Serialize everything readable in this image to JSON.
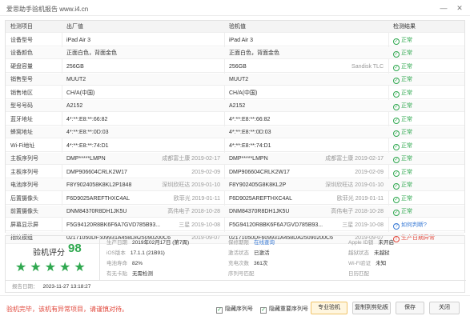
{
  "window": {
    "title": "爱思助手验机报告 www.i4.cn",
    "min": "—",
    "close": "✕"
  },
  "table": {
    "headers": {
      "name": "检测项目",
      "factory": "出厂值",
      "check": "验机值",
      "result": "检测结果"
    },
    "rows": [
      {
        "name": "设备型号",
        "factory": "iPad Air 3",
        "factory_extra": "",
        "check": "iPad Air 3",
        "check_extra": "",
        "result": "正常",
        "status": "ok"
      },
      {
        "name": "设备颜色",
        "factory": "正面白色，背面金色",
        "factory_extra": "",
        "check": "正面白色，背面金色",
        "check_extra": "",
        "result": "正常",
        "status": "ok"
      },
      {
        "name": "硬盘容量",
        "factory": "256GB",
        "factory_extra": "",
        "check": "256GB",
        "check_extra": "Sandisk TLC",
        "result": "正常",
        "status": "ok"
      },
      {
        "name": "销售型号",
        "factory": "MUUT2",
        "factory_extra": "",
        "check": "MUUT2",
        "check_extra": "",
        "result": "正常",
        "status": "ok"
      },
      {
        "name": "销售地区",
        "factory": "CH/A(中国)",
        "factory_extra": "",
        "check": "CH/A(中国)",
        "check_extra": "",
        "result": "正常",
        "status": "ok"
      },
      {
        "name": "型号号码",
        "factory": "A2152",
        "factory_extra": "",
        "check": "A2152",
        "check_extra": "",
        "result": "正常",
        "status": "ok"
      },
      {
        "name": "蓝牙地址",
        "factory": "4*:**:E8:**:66:82",
        "factory_extra": "",
        "check": "4*:**:E8:**:66:82",
        "check_extra": "",
        "result": "正常",
        "status": "ok"
      },
      {
        "name": "蜂窝地址",
        "factory": "4*:**:E8:**:0D:03",
        "factory_extra": "",
        "check": "4*:**:E8:**:0D:03",
        "check_extra": "",
        "result": "正常",
        "status": "ok"
      },
      {
        "name": "Wi-Fi地址",
        "factory": "4*:**:E8:**:74:D1",
        "factory_extra": "",
        "check": "4*:**:E8:**:74:D1",
        "check_extra": "",
        "result": "正常",
        "status": "ok"
      },
      {
        "name": "主板序列号",
        "factory": "DMP*****LMPN",
        "factory_extra": "成都富士康 2019-02-17",
        "check": "DMP*****LMPN",
        "check_extra": "成都富士康 2019-02-17",
        "result": "正常",
        "status": "ok"
      },
      {
        "name": "主板序列号",
        "factory": "DMP906604CRLK2W17",
        "factory_extra": "2019-02-09",
        "check": "DMP906604CRLK2W17",
        "check_extra": "2019-02-09",
        "result": "正常",
        "status": "ok"
      },
      {
        "name": "电池序列号",
        "factory": "F8Y9024058K8KL2P1848",
        "factory_extra": "深圳欣旺达 2019-01-10",
        "check": "F8Y902405G8K8KL2P",
        "check_extra": "深圳欣旺达 2019-01-10",
        "result": "正常",
        "status": "ok"
      },
      {
        "name": "后置摄像头",
        "factory": "F6D9025AREFTHXC4AL",
        "factory_extra": "欧菲光 2019-01-11",
        "check": "F6D9025AREFTHXC4AL",
        "check_extra": "欧菲光 2019-01-11",
        "result": "正常",
        "status": "ok"
      },
      {
        "name": "前置摄像头",
        "factory": "DNM84370R8DH1JK5U",
        "factory_extra": "高伟电子 2018-10-28",
        "check": "DNM84370R8DH1JK5U",
        "check_extra": "高伟电子 2018-10-28",
        "result": "正常",
        "status": "ok"
      },
      {
        "name": "屏幕显示屏",
        "factory": "F5G94120R8BK6F6A7GVD785B93...",
        "factory_extra": "三星 2019-10-08",
        "check": "F5G94120R8BK6F6A7GVD785B93...",
        "check_extra": "三星 2019-10-08",
        "result": "如何判断?",
        "status": "question"
      },
      {
        "name": "指纹模组",
        "factory": "02171050DF609931A458DA25090200C6",
        "factory_extra": "2019-09-07",
        "check": "02171050DF609931A458DA25090200C6",
        "check_extra": "2019-09-07",
        "result": "生产日期异常",
        "status": "bad"
      }
    ]
  },
  "summary": {
    "score_label": "验机评分",
    "score": "98",
    "stars": "★★★★★",
    "items": [
      {
        "k": "生产日期",
        "v": "2019年02月17日 (第7周)"
      },
      {
        "k": "保修期限",
        "v": "在线查询",
        "style": "link"
      },
      {
        "k": "Apple ID锁",
        "v": "未开启"
      },
      {
        "k": "iOS版本",
        "v": "17.1.1 (21B91)"
      },
      {
        "k": "激活状态",
        "v": "已激活"
      },
      {
        "k": "越狱状态",
        "v": "未越狱"
      },
      {
        "k": "电池寿命",
        "v": "82%"
      },
      {
        "k": "充电次数",
        "v": "361次"
      },
      {
        "k": "Wi-Fi验证",
        "v": "未知"
      },
      {
        "k": "有无卡贴",
        "v": "无需检测"
      },
      {
        "k": "序列号匹配",
        "v": ""
      },
      {
        "k": "日历匹配",
        "v": ""
      }
    ],
    "report_time_k": "报告日期：",
    "report_time_v": "2023-11-27 13:18:27"
  },
  "footer": {
    "warning": "验机完毕，该机有异常项目，请谨慎对待。",
    "cb1": "隐藏序列号",
    "cb2": "隐藏重要序列号",
    "btn_pro": "专业验机",
    "btn_copy": "复制到剪贴板",
    "btn_save": "保存",
    "btn_close": "关闭"
  },
  "colors": {
    "ok": "#2fa84f",
    "link": "#3a7bd5",
    "bad": "#e0463a"
  }
}
